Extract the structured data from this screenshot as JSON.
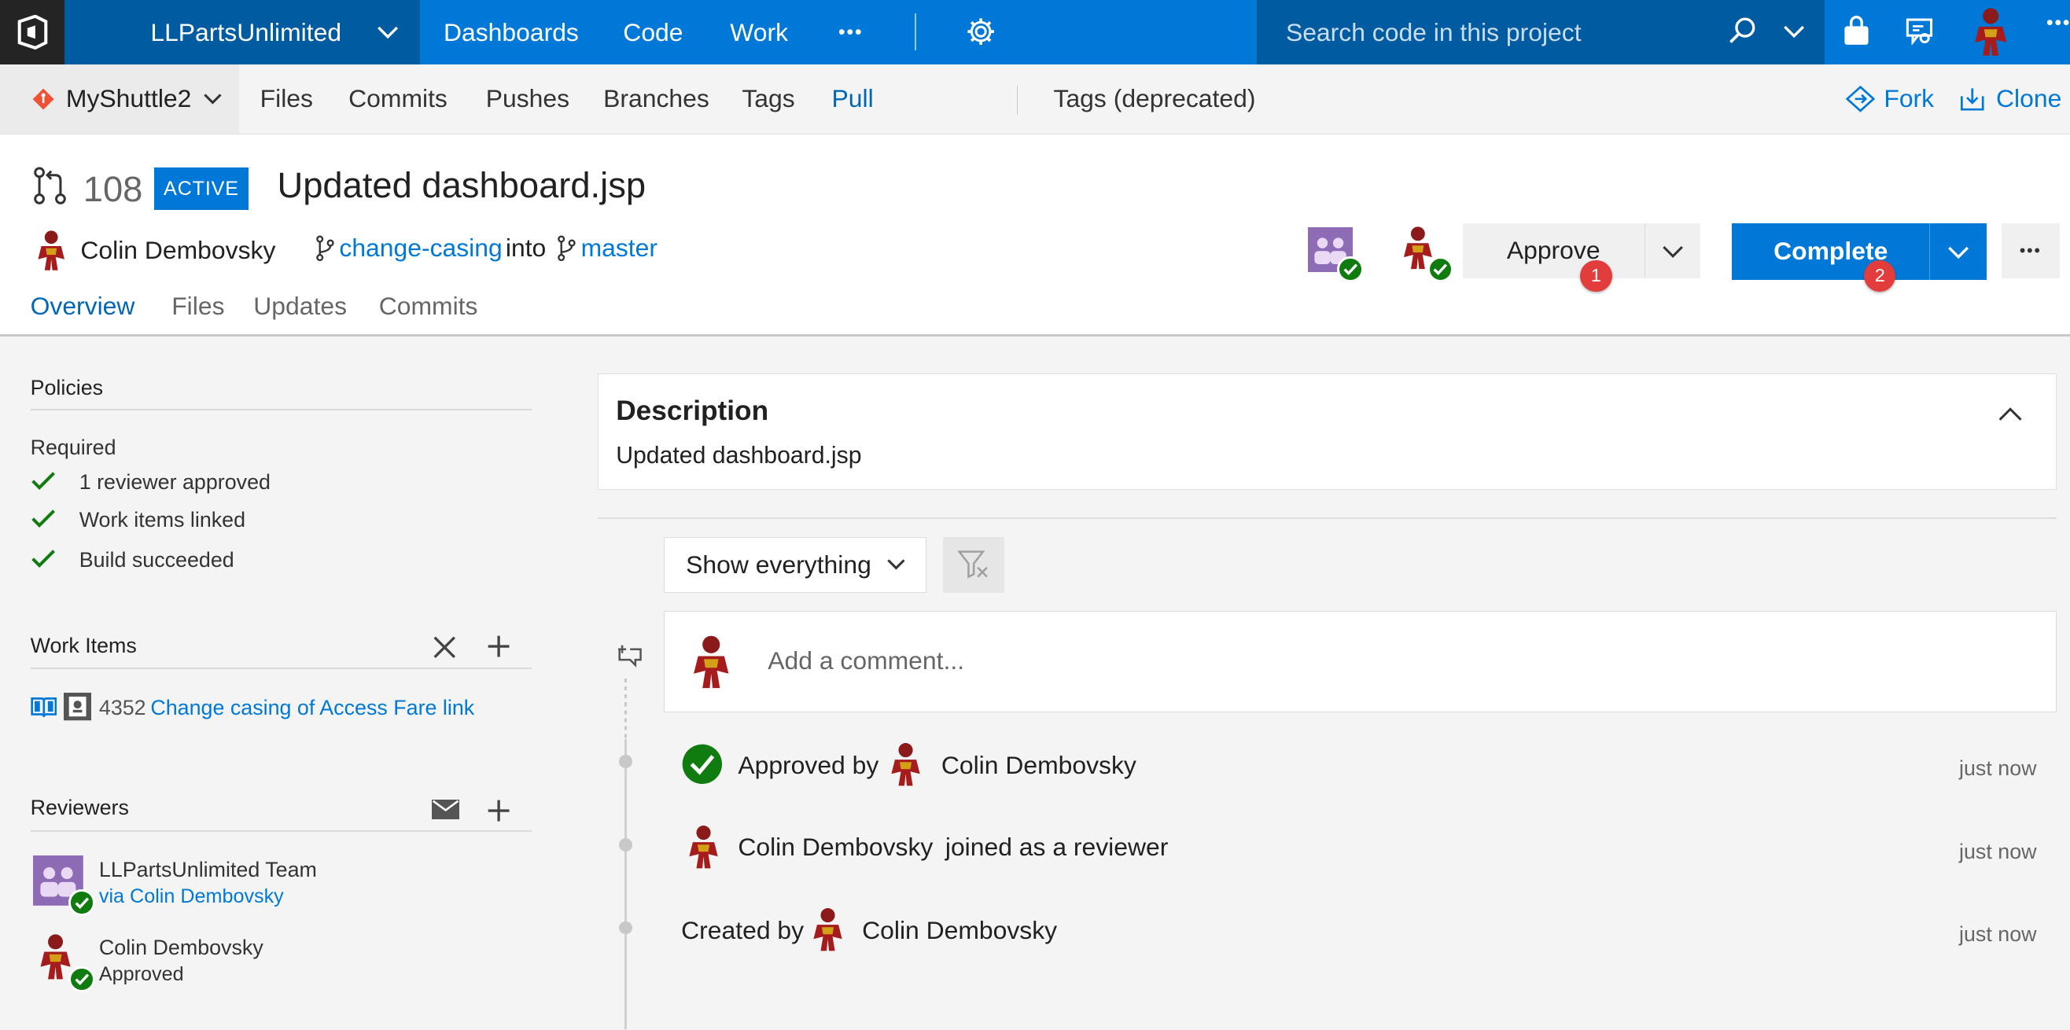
{
  "topbar": {
    "project": "LLPartsUnlimited",
    "nav": [
      "Dashboards",
      "Code",
      "Work"
    ],
    "more": "•••",
    "search_placeholder": "Search code in this project"
  },
  "subnav": {
    "repo": "MyShuttle2",
    "links": [
      "Files",
      "Commits",
      "Pushes",
      "Branches",
      "Tags",
      "Pull Requests",
      "Tags (deprecated)"
    ],
    "fork": "Fork",
    "clone": "Clone"
  },
  "pr": {
    "id": "108",
    "status": "ACTIVE",
    "title": "Updated dashboard.jsp",
    "author": "Colin Dembovsky",
    "source_branch": "change-casing",
    "into": "into",
    "target_branch": "master",
    "approve_label": "Approve",
    "complete_label": "Complete",
    "badge1": "1",
    "badge2": "2",
    "tabs": [
      "Overview",
      "Files",
      "Updates",
      "Commits"
    ]
  },
  "policies": {
    "title": "Policies",
    "required": "Required",
    "items": [
      "1 reviewer approved",
      "Work items linked",
      "Build succeeded"
    ]
  },
  "work_items": {
    "title": "Work Items",
    "id": "4352",
    "link": "Change casing of Access Fare link"
  },
  "reviewers": {
    "title": "Reviewers",
    "list": [
      {
        "name": "LLPartsUnlimited Team",
        "sub": "via Colin Dembovsky"
      },
      {
        "name": "Colin Dembovsky",
        "sub": "Approved"
      }
    ]
  },
  "description": {
    "title": "Description",
    "text": "Updated dashboard.jsp"
  },
  "activity": {
    "filter": "Show everything",
    "comment_placeholder": "Add a comment...",
    "events": [
      {
        "prefix": "Approved by",
        "who": "Colin Dembovsky",
        "suffix": "",
        "time": "just now"
      },
      {
        "prefix": "",
        "who": "Colin Dembovsky",
        "suffix": "joined as a reviewer",
        "time": "just now"
      },
      {
        "prefix": "Created by",
        "who": "Colin Dembovsky",
        "suffix": "",
        "time": "just now"
      }
    ]
  },
  "colors": {
    "accent": "#0078d7",
    "dark_accent": "#005ba1",
    "success": "#107c10",
    "badge_red": "#e33c3c"
  },
  "icons": [
    "vsts-logo-icon",
    "chevron-down-icon",
    "gear-icon",
    "search-icon",
    "shopping-bag-icon",
    "feedback-icon",
    "git-repo-icon",
    "fork-icon",
    "clone-icon",
    "pull-request-icon",
    "branch-icon",
    "check-icon",
    "close-icon",
    "plus-icon",
    "mail-icon",
    "book-icon",
    "work-item-icon",
    "funnel-clear-icon",
    "add-comment-icon",
    "chevron-up-icon",
    "more-icon"
  ]
}
